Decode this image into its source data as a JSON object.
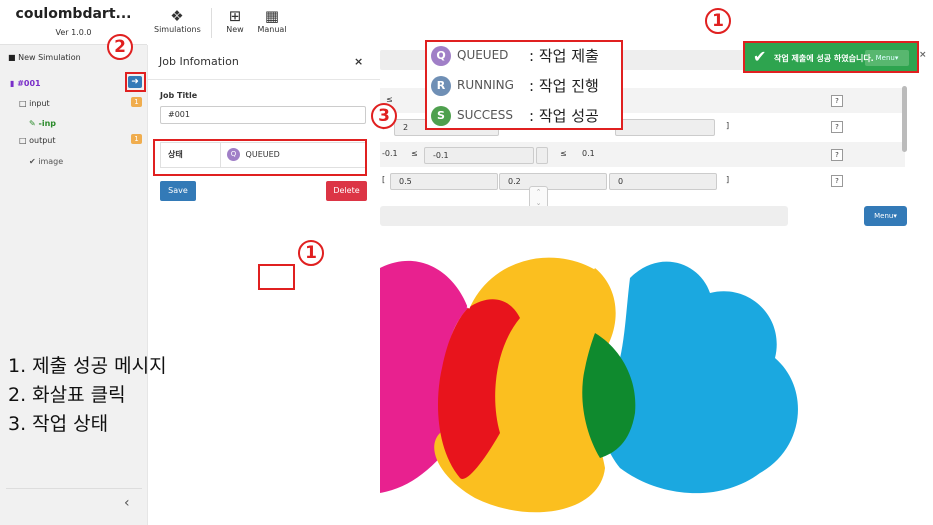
{
  "app": {
    "name": "coulombdart...",
    "version": "Ver 1.0.0"
  },
  "toolbar": {
    "simulations_label": "Simulations",
    "new_label": "New",
    "manual_label": "Manual"
  },
  "sidebar": {
    "new_simulation": "New Simulation",
    "sim_id": "#001",
    "input_label": "input",
    "input_count": "1",
    "inp_file": "-inp",
    "output_label": "output",
    "output_count": "1",
    "image_label": "image",
    "collapse_icon": "‹"
  },
  "job_panel": {
    "title": "Job Infomation",
    "close": "×",
    "job_title_label": "Job Title",
    "job_title_value": "#001",
    "status_key": "상태",
    "status_letter": "Q",
    "status_value": "QUEUED",
    "save_label": "Save",
    "delete_label": "Delete"
  },
  "form": {
    "rows": [
      {
        "c1": "",
        "c2": "≤",
        "c3": "",
        "c4": "",
        "c5": ""
      },
      {
        "c1": "",
        "c2": "[",
        "c3": "2",
        "c4": "",
        "c5": ""
      },
      {
        "c1": "-0.1",
        "c2": "≤",
        "c3": "-0.1",
        "c4": "≤",
        "c5": "0.1"
      },
      {
        "c1": "",
        "c2": "[",
        "c3": "0.5",
        "c4": "0.2",
        "c5": "0"
      }
    ],
    "bracket_close": "]",
    "help": "?",
    "menu_label": "Menu▾"
  },
  "toast": {
    "message": "작업 제출에 성공 하였습니다.",
    "menu_ghost": "Menu▾",
    "close": "×"
  },
  "legend": {
    "items": [
      {
        "letter": "Q",
        "code": "QUEUED",
        "desc": ": 작업 제출",
        "color": "#a07fc7"
      },
      {
        "letter": "R",
        "code": "RUNNING",
        "desc": ": 작업 진행",
        "color": "#6f8fb5"
      },
      {
        "letter": "S",
        "code": "SUCCESS",
        "desc": ": 작업 성공",
        "color": "#4ea04e"
      }
    ]
  },
  "annotations": {
    "n1": "1",
    "n2": "2",
    "n3": "3",
    "notes": [
      "1. 제출 성공 메시지",
      "2. 화살표 클릭",
      "3. 작업 상태"
    ]
  },
  "colors": {
    "primary": "#337ab7",
    "danger": "#dc3545",
    "success": "#2ea44f",
    "warning": "#f0ad4e",
    "annotation_red": "#e02020",
    "logo_magenta": "#e8218f",
    "logo_yellow": "#fbbf1f",
    "logo_blue": "#1ba8e0",
    "logo_red": "#e8141c",
    "logo_green": "#0f8a2e"
  }
}
